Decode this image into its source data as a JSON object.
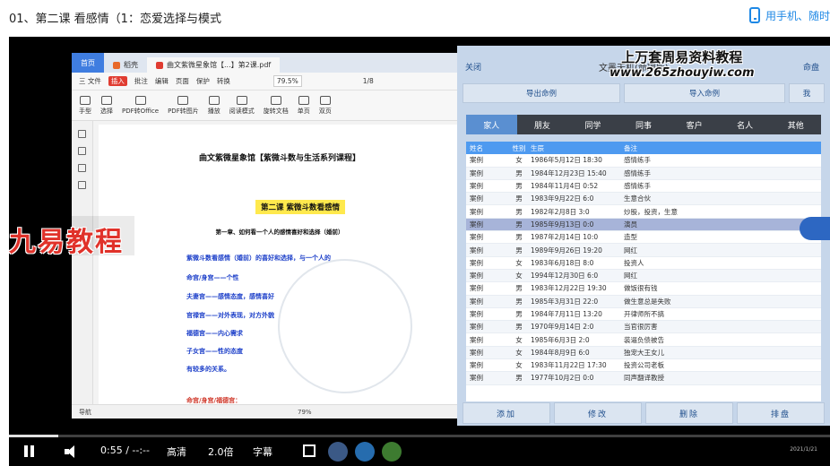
{
  "top": {
    "course_title": "01、第二课 看感情（1：恋爱选择与模式",
    "phone_link": "用手机、随时"
  },
  "pdf": {
    "tabs": [
      "首页",
      "稻壳",
      "曲文紫微星象馆【...】第2课.pdf"
    ],
    "menu": [
      "三 文件",
      "插入",
      "批注",
      "编辑",
      "页面",
      "保护",
      "转换"
    ],
    "tools": [
      "手型",
      "选择",
      "PDF转Office",
      "PDF转图片",
      "播放",
      "阅读模式",
      "旋转文档",
      "单页",
      "双页"
    ],
    "zoom": "79.5%",
    "page_indicator": "1/8",
    "status_zoom": "79%",
    "status_nav": "导航",
    "doc": {
      "title": "曲文紫微星象馆【紫微斗数与生活系列课程】",
      "lesson": "第二课  紫微斗数看感情",
      "chapter": "第一章、如何看一个人的感情喜好和选择（婚前）",
      "lines": [
        "紫微斗数看感情（婚前）的喜好和选择，与一个人的",
        "命宫/身宫——个性",
        "夫妻宫——感情态度，感情喜好",
        "官禄宫——对外表现，对方外貌",
        "福德宫——内心需求",
        "子女宫——性的态度",
        "有较多的关系。"
      ],
      "last_line": "命宫/身宫/福德宫："
    }
  },
  "overlay": {
    "jiuyi": "九易教程",
    "site_title": "上万套周易资料教程",
    "site_url": "www.265zhouyiw.com"
  },
  "app": {
    "close": "关闭",
    "title": "文墨天机(命理版)",
    "right": "命盘",
    "actions": [
      "导出命例",
      "导入命例",
      "我"
    ],
    "categories": [
      "家人",
      "朋友",
      "同学",
      "同事",
      "客户",
      "名人",
      "其他"
    ],
    "active_category": "家人",
    "headers": [
      "姓名",
      "性别",
      "生辰",
      "备注"
    ],
    "rows": [
      [
        "案例",
        "女",
        "1986年5月12日 18:30",
        "感情练手"
      ],
      [
        "案例",
        "男",
        "1984年12月23日 15:40",
        "感情练手"
      ],
      [
        "案例",
        "男",
        "1984年11月4日 0:52",
        "感情练手"
      ],
      [
        "案例",
        "男",
        "1983年9月22日 6:0",
        "生意合伙"
      ],
      [
        "案例",
        "男",
        "1982年2月8日 3:0",
        "炒股，投资，生意"
      ],
      [
        "案例",
        "男",
        "1985年9月13日 0:0",
        "演员"
      ],
      [
        "案例",
        "男",
        "1987年2月14日 10:0",
        "造型"
      ],
      [
        "案例",
        "男",
        "1989年9月26日 19:20",
        "网红"
      ],
      [
        "案例",
        "女",
        "1983年6月18日 8:0",
        "投资人"
      ],
      [
        "案例",
        "女",
        "1994年12月30日 6:0",
        "网红"
      ],
      [
        "案例",
        "男",
        "1983年12月22日 19:30",
        "做饭很有钱"
      ],
      [
        "案例",
        "男",
        "1985年3月31日 22:0",
        "做生意总是失败"
      ],
      [
        "案例",
        "男",
        "1984年7月11日 13:20",
        "开律师所不搞"
      ],
      [
        "案例",
        "男",
        "1970年9月14日 2:0",
        "当官很厉害"
      ],
      [
        "案例",
        "女",
        "1985年6月3日 2:0",
        "装逼负债被告"
      ],
      [
        "案例",
        "女",
        "1984年8月9日 6:0",
        "独宠大王女儿"
      ],
      [
        "案例",
        "女",
        "1983年11月22日 17:30",
        "投资公司老板"
      ],
      [
        "案例",
        "男",
        "1977年10月2日 0:0",
        "同声翻译教授"
      ]
    ],
    "selected_row": 5,
    "bottom": [
      "添加",
      "修改",
      "删除",
      "排盘"
    ]
  },
  "player": {
    "time": "0:55 / --:--",
    "quality": "高清",
    "speed": "2.0倍",
    "subtitle": "字幕",
    "progress": 0.06,
    "clock": "2021/1/21"
  }
}
